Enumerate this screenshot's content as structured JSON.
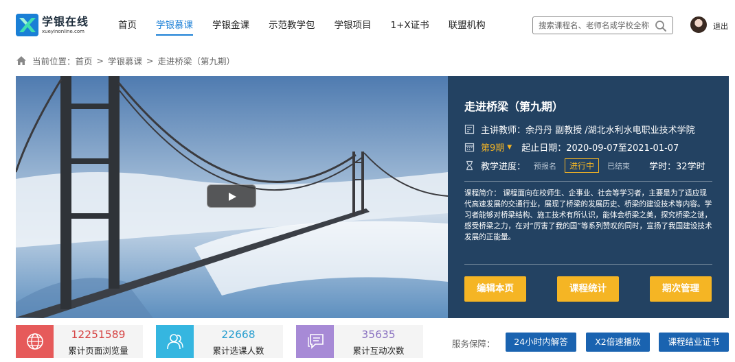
{
  "brand": {
    "name_cn": "学银在线",
    "name_en": "xueyinonline.com",
    "logo_icon": "xueyin-logo-icon"
  },
  "nav": {
    "items": [
      {
        "label": "首页",
        "active": false
      },
      {
        "label": "学银慕课",
        "active": true
      },
      {
        "label": "学银金课",
        "active": false
      },
      {
        "label": "示范教学包",
        "active": false
      },
      {
        "label": "学银项目",
        "active": false
      },
      {
        "label": "1+X证书",
        "active": false
      },
      {
        "label": "联盟机构",
        "active": false
      }
    ],
    "accent_color": "#1a7fd6"
  },
  "search": {
    "placeholder": "搜索课程名、老师名或学校全称",
    "icon": "search-icon"
  },
  "user": {
    "logout_label": "退出"
  },
  "breadcrumb": {
    "prefix": "当前位置：",
    "items": [
      "首页",
      "学银慕课",
      "走进桥梁（第九期）"
    ],
    "separator": ">"
  },
  "course": {
    "title": "走进桥梁（第九期）",
    "teacher_label": "主讲教师：",
    "teacher": "余丹丹 副教授 /湖北水利水电职业技术学院",
    "term": "第9期",
    "date_label": "起止日期：",
    "dates": "2020-09-07至2021-01-07",
    "progress_label": "教学进度：",
    "stages": [
      "预报名",
      "进行中",
      "已结束"
    ],
    "current_stage": "进行中",
    "hours": "学时：32学时",
    "intro": "课程简介：  课程面向在校师生、企事业、社会等学习者，主要是为了适应现代高速发展的交通行业，展现了桥梁的发展历史、桥梁的建设技术等内容。学习者能够对桥梁结构、施工技术有所认识，能体会桥梁之美，探究桥梁之谜，感受桥梁之力，在对“厉害了我的国”等系列赞叹的同时，宣扬了我国建设技术发展的正能量。",
    "panel_color": "#234262",
    "highlight_color": "#f5b524"
  },
  "actions": {
    "edit": "编辑本页",
    "stats": "课程统计",
    "term_manage": "期次管理"
  },
  "stats": [
    {
      "value": "12251589",
      "label": "累计页面浏览量",
      "color": "#e65a5a",
      "text_color": "#d64545",
      "icon": "globe-icon"
    },
    {
      "value": "22668",
      "label": "累计选课人数",
      "color": "#35b6e0",
      "text_color": "#2a9fd0",
      "icon": "users-icon"
    },
    {
      "value": "35635",
      "label": "累计互动次数",
      "color": "#a78ad6",
      "text_color": "#8c74c2",
      "icon": "chat-icon"
    }
  ],
  "service": {
    "label": "服务保障：",
    "items": [
      "24小时内解答",
      "X2倍速播放",
      "课程结业证书"
    ]
  }
}
